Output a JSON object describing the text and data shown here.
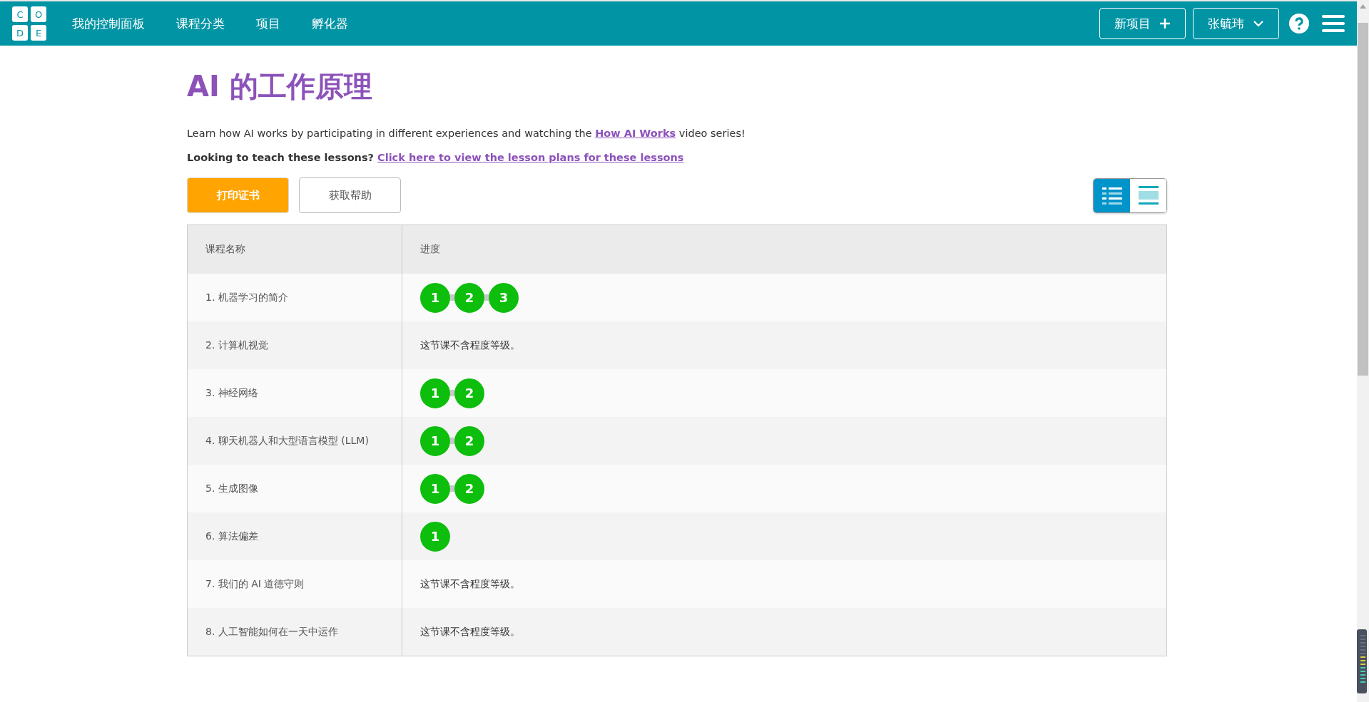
{
  "header": {
    "logo_letters": [
      "C",
      "O",
      "D",
      "E"
    ],
    "nav": [
      "我的控制面板",
      "课程分类",
      "项目",
      "孵化器"
    ],
    "new_project_button": "新项目",
    "user_button": "张毓玮"
  },
  "page": {
    "title": "AI 的工作原理",
    "intro": "Learn how AI works by participating in different experiences and watching the ",
    "intro_link": "How AI Works",
    "intro_end": " video series!",
    "teach_text": "Looking to teach these lessons? ",
    "teach_link": "Click here to view the lesson plans for these lessons"
  },
  "buttons": {
    "print": "打印证书",
    "help": "获取帮助"
  },
  "view_toggle": [
    {
      "kind": "detail",
      "selected": true
    },
    {
      "kind": "summary",
      "selected": false
    }
  ],
  "table": {
    "columns": [
      "课程名称",
      "进度"
    ],
    "rows": [
      {
        "name": "1. 机器学习的简介",
        "levels": [
          {
            "label": "1",
            "completed": true
          },
          {
            "label": "2",
            "completed": true
          },
          {
            "label": "3",
            "completed": true
          }
        ]
      },
      {
        "name": "2. 计算机视觉",
        "note": "这节课不含程度等级。"
      },
      {
        "name": "3. 神经网络",
        "levels": [
          {
            "label": "1",
            "completed": true
          },
          {
            "label": "2",
            "completed": true
          }
        ]
      },
      {
        "name": "4. 聊天机器人和大型语言模型 (LLM)",
        "levels": [
          {
            "label": "1",
            "completed": true
          },
          {
            "label": "2",
            "completed": true
          }
        ]
      },
      {
        "name": "5. 生成图像",
        "levels": [
          {
            "label": "1",
            "completed": true
          },
          {
            "label": "2",
            "completed": true
          }
        ]
      },
      {
        "name": "6. 算法偏差",
        "levels": [
          {
            "label": "1",
            "completed": true
          }
        ]
      },
      {
        "name": "7. 我们的 AI 道德守则",
        "note": "这节课不含程度等级。"
      },
      {
        "name": "8. 人工智能如何在一天中运作",
        "note": "这节课不含程度等级。"
      }
    ]
  }
}
